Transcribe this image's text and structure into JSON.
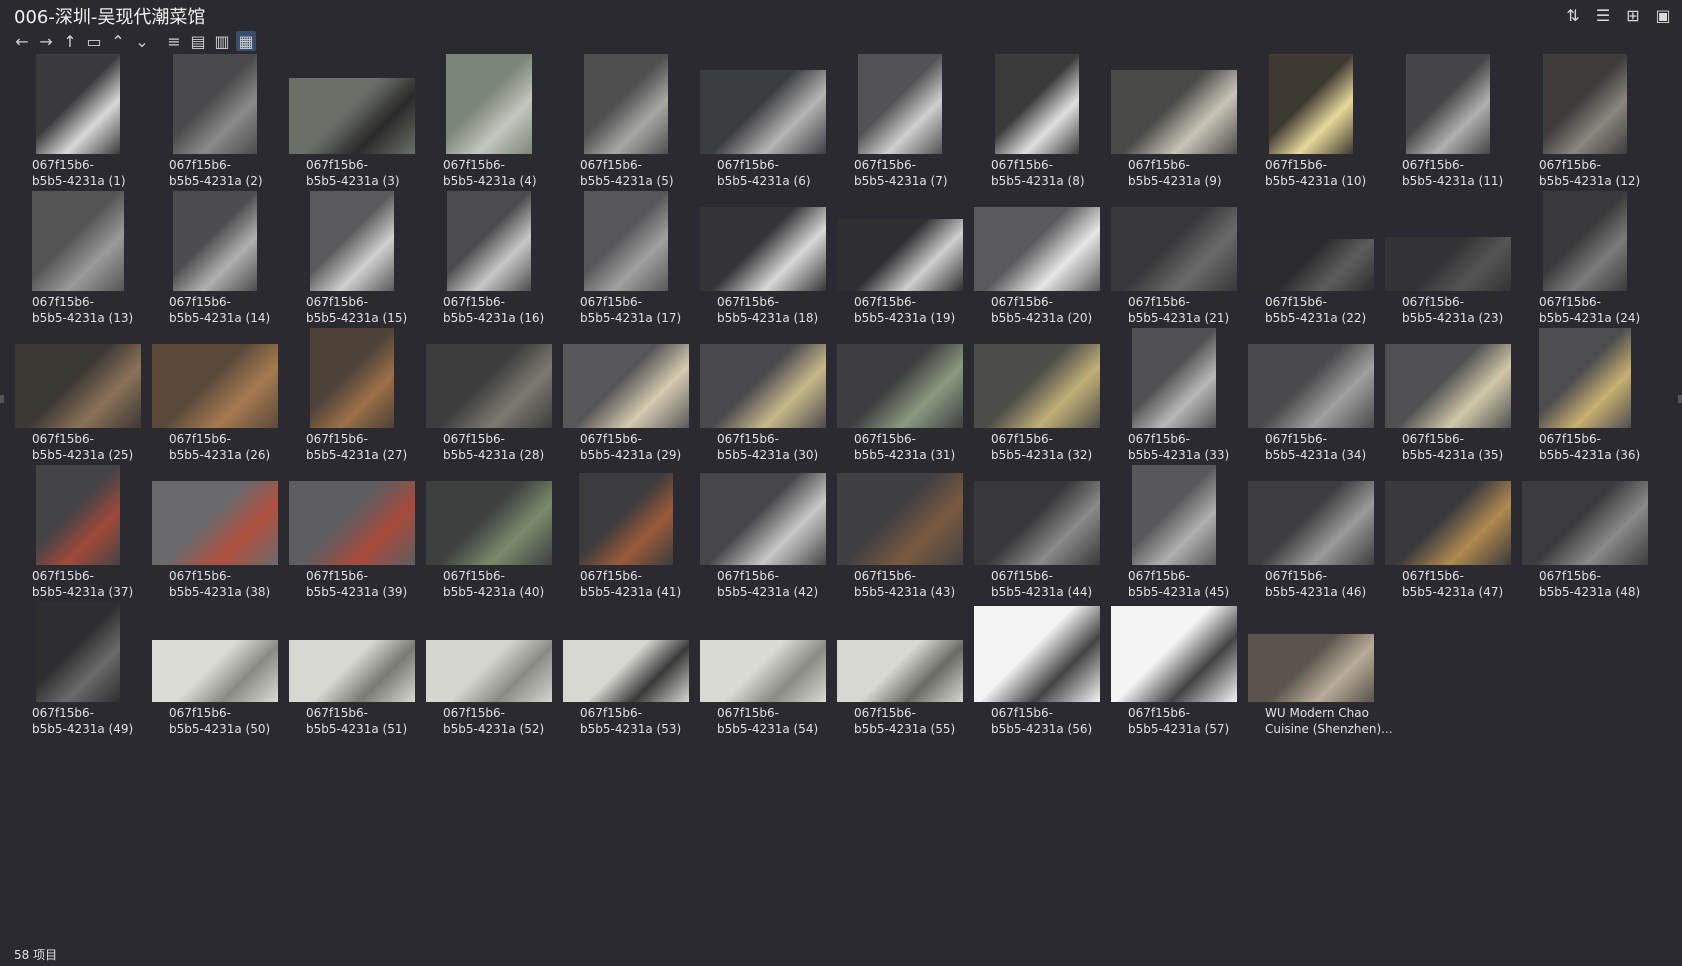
{
  "window": {
    "title": "006-深圳-吴现代潮菜馆"
  },
  "window_actions": [
    {
      "name": "sort-icon",
      "glyph": "⇅"
    },
    {
      "name": "details-pane-icon",
      "glyph": "☰"
    },
    {
      "name": "new-item-icon",
      "glyph": "⊞"
    },
    {
      "name": "clipboard-icon",
      "glyph": "▣"
    }
  ],
  "toolbar": [
    {
      "name": "back-icon",
      "glyph": "←"
    },
    {
      "name": "forward-icon",
      "glyph": "→"
    },
    {
      "name": "up-icon",
      "glyph": "↑"
    },
    {
      "name": "folder-icon",
      "glyph": "▭"
    },
    {
      "name": "chevron-up-icon",
      "glyph": "⌃"
    },
    {
      "name": "chevron-down-icon",
      "glyph": "⌄"
    },
    {
      "name": "list-view-icon",
      "glyph": "≡"
    },
    {
      "name": "details-view-icon",
      "glyph": "▤"
    },
    {
      "name": "tiles-view-icon",
      "glyph": "▥"
    },
    {
      "name": "thumbnail-view-icon",
      "glyph": "▦"
    }
  ],
  "items": [
    {
      "l1": "067f15b6-",
      "l2": "b5b5-4231a (1)",
      "thumb": "#3a3a3c",
      "accent": "#d8d8d8",
      "w": 84,
      "h": 100
    },
    {
      "l1": "067f15b6-",
      "l2": "b5b5-4231a (2)",
      "thumb": "#4a4a4c",
      "accent": "#8a8a8a",
      "w": 84,
      "h": 100
    },
    {
      "l1": "067f15b6-",
      "l2": "b5b5-4231a (3)",
      "thumb": "#6b6f68",
      "accent": "#2a2a2a",
      "w": 126,
      "h": 76
    },
    {
      "l1": "067f15b6-",
      "l2": "b5b5-4231a (4)",
      "thumb": "#7c8676",
      "accent": "#c4c6c0",
      "w": 86,
      "h": 100
    },
    {
      "l1": "067f15b6-",
      "l2": "b5b5-4231a (5)",
      "thumb": "#4f4f50",
      "accent": "#a8a8a4",
      "w": 84,
      "h": 100
    },
    {
      "l1": "067f15b6-",
      "l2": "b5b5-4231a (6)",
      "thumb": "#3c3d40",
      "accent": "#b5b5b5",
      "w": 126,
      "h": 84
    },
    {
      "l1": "067f15b6-",
      "l2": "b5b5-4231a (7)",
      "thumb": "#525254",
      "accent": "#cfcfcf",
      "w": 84,
      "h": 100
    },
    {
      "l1": "067f15b6-",
      "l2": "b5b5-4231a (8)",
      "thumb": "#3b3b3c",
      "accent": "#e0e0e0",
      "w": 84,
      "h": 100
    },
    {
      "l1": "067f15b6-",
      "l2": "b5b5-4231a (9)",
      "thumb": "#4a4a48",
      "accent": "#c8c5b8",
      "w": 126,
      "h": 84
    },
    {
      "l1": "067f15b6-",
      "l2": "b5b5-4231a (10)",
      "thumb": "#3e3a32",
      "accent": "#e8d89a",
      "w": 84,
      "h": 100
    },
    {
      "l1": "067f15b6-",
      "l2": "b5b5-4231a (11)",
      "thumb": "#454547",
      "accent": "#b0b0b0",
      "w": 84,
      "h": 100
    },
    {
      "l1": "067f15b6-",
      "l2": "b5b5-4231a (12)",
      "thumb": "#3d3c3b",
      "accent": "#8a8680",
      "w": 84,
      "h": 100
    },
    {
      "l1": "067f15b6-",
      "l2": "b5b5-4231a (13)",
      "thumb": "#555556",
      "accent": "#9a9a9a",
      "w": 92,
      "h": 100
    },
    {
      "l1": "067f15b6-",
      "l2": "b5b5-4231a (14)",
      "thumb": "#4c4c4e",
      "accent": "#b0b0b0",
      "w": 84,
      "h": 100
    },
    {
      "l1": "067f15b6-",
      "l2": "b5b5-4231a (15)",
      "thumb": "#5a5a5c",
      "accent": "#d0d0d0",
      "w": 84,
      "h": 100
    },
    {
      "l1": "067f15b6-",
      "l2": "b5b5-4231a (16)",
      "thumb": "#4d4d4f",
      "accent": "#c8c8c8",
      "w": 84,
      "h": 100
    },
    {
      "l1": "067f15b6-",
      "l2": "b5b5-4231a (17)",
      "thumb": "#58585a",
      "accent": "#a0a0a0",
      "w": 84,
      "h": 100
    },
    {
      "l1": "067f15b6-",
      "l2": "b5b5-4231a (18)",
      "thumb": "#353537",
      "accent": "#d8d8d8",
      "w": 126,
      "h": 84
    },
    {
      "l1": "067f15b6-",
      "l2": "b5b5-4231a (19)",
      "thumb": "#2f2f31",
      "accent": "#cfcfcf",
      "w": 126,
      "h": 72
    },
    {
      "l1": "067f15b6-",
      "l2": "b5b5-4231a (20)",
      "thumb": "#5a5a5c",
      "accent": "#e6e6e6",
      "w": 126,
      "h": 84
    },
    {
      "l1": "067f15b6-",
      "l2": "b5b5-4231a (21)",
      "thumb": "#38383a",
      "accent": "#6a6a6a",
      "w": 126,
      "h": 84
    },
    {
      "l1": "067f15b6-",
      "l2": "b5b5-4231a (22)",
      "thumb": "#2c2c2e",
      "accent": "#5e5e5e",
      "w": 126,
      "h": 52
    },
    {
      "l1": "067f15b6-",
      "l2": "b5b5-4231a (23)",
      "thumb": "#333335",
      "accent": "#555555",
      "w": 126,
      "h": 54
    },
    {
      "l1": "067f15b6-",
      "l2": "b5b5-4231a (24)",
      "thumb": "#3a3a3c",
      "accent": "#7a7a7a",
      "w": 84,
      "h": 100
    },
    {
      "l1": "067f15b6-",
      "l2": "b5b5-4231a (25)",
      "thumb": "#3c3834",
      "accent": "#8c7358",
      "w": 126,
      "h": 84
    },
    {
      "l1": "067f15b6-",
      "l2": "b5b5-4231a (26)",
      "thumb": "#5a4a3c",
      "accent": "#a67a4e",
      "w": 126,
      "h": 84
    },
    {
      "l1": "067f15b6-",
      "l2": "b5b5-4231a (27)",
      "thumb": "#4e4238",
      "accent": "#9c7048",
      "w": 84,
      "h": 100
    },
    {
      "l1": "067f15b6-",
      "l2": "b5b5-4231a (28)",
      "thumb": "#3c3c3c",
      "accent": "#7c7a70",
      "w": 126,
      "h": 84
    },
    {
      "l1": "067f15b6-",
      "l2": "b5b5-4231a (29)",
      "thumb": "#58585a",
      "accent": "#d6cbb0",
      "w": 126,
      "h": 84
    },
    {
      "l1": "067f15b6-",
      "l2": "b5b5-4231a (30)",
      "thumb": "#4a4a4c",
      "accent": "#c8b88a",
      "w": 126,
      "h": 84
    },
    {
      "l1": "067f15b6-",
      "l2": "b5b5-4231a (31)",
      "thumb": "#3e3e40",
      "accent": "#8a9a80",
      "w": 126,
      "h": 84
    },
    {
      "l1": "067f15b6-",
      "l2": "b5b5-4231a (32)",
      "thumb": "#4c4c48",
      "accent": "#c0b078",
      "w": 126,
      "h": 84
    },
    {
      "l1": "067f15b6-",
      "l2": "b5b5-4231a (33)",
      "thumb": "#505052",
      "accent": "#b8b8b8",
      "w": 84,
      "h": 100
    },
    {
      "l1": "067f15b6-",
      "l2": "b5b5-4231a (34)",
      "thumb": "#4a4a4c",
      "accent": "#a0a0a0",
      "w": 126,
      "h": 84
    },
    {
      "l1": "067f15b6-",
      "l2": "b5b5-4231a (35)",
      "thumb": "#505052",
      "accent": "#d0c8a8",
      "w": 126,
      "h": 84
    },
    {
      "l1": "067f15b6-",
      "l2": "b5b5-4231a (36)",
      "thumb": "#4e4e50",
      "accent": "#c8b070",
      "w": 92,
      "h": 100
    },
    {
      "l1": "067f15b6-",
      "l2": "b5b5-4231a (37)",
      "thumb": "#444446",
      "accent": "#a04a3a",
      "w": 84,
      "h": 100
    },
    {
      "l1": "067f15b6-",
      "l2": "b5b5-4231a (38)",
      "thumb": "#6a6a6c",
      "accent": "#b0503e",
      "w": 126,
      "h": 84
    },
    {
      "l1": "067f15b6-",
      "l2": "b5b5-4231a (39)",
      "thumb": "#5e5e60",
      "accent": "#a84a3c",
      "w": 126,
      "h": 84
    },
    {
      "l1": "067f15b6-",
      "l2": "b5b5-4231a (40)",
      "thumb": "#3e4040",
      "accent": "#7a8a6a",
      "w": 126,
      "h": 84
    },
    {
      "l1": "067f15b6-",
      "l2": "b5b5-4231a (41)",
      "thumb": "#3c3c3e",
      "accent": "#9a5a3a",
      "w": 94,
      "h": 92
    },
    {
      "l1": "067f15b6-",
      "l2": "b5b5-4231a (42)",
      "thumb": "#464648",
      "accent": "#c8c8c8",
      "w": 126,
      "h": 92
    },
    {
      "l1": "067f15b6-",
      "l2": "b5b5-4231a (43)",
      "thumb": "#404042",
      "accent": "#7a5a40",
      "w": 126,
      "h": 92
    },
    {
      "l1": "067f15b6-",
      "l2": "b5b5-4231a (44)",
      "thumb": "#38383a",
      "accent": "#8a8a8a",
      "w": 126,
      "h": 84
    },
    {
      "l1": "067f15b6-",
      "l2": "b5b5-4231a (45)",
      "thumb": "#58585a",
      "accent": "#b0b0b0",
      "w": 84,
      "h": 100
    },
    {
      "l1": "067f15b6-",
      "l2": "b5b5-4231a (46)",
      "thumb": "#3e3e40",
      "accent": "#9a9a9a",
      "w": 126,
      "h": 84
    },
    {
      "l1": "067f15b6-",
      "l2": "b5b5-4231a (47)",
      "thumb": "#3a3a3c",
      "accent": "#b08a50",
      "w": 126,
      "h": 84
    },
    {
      "l1": "067f15b6-",
      "l2": "b5b5-4231a (48)",
      "thumb": "#3c3c3e",
      "accent": "#8a8a8a",
      "w": 126,
      "h": 84
    },
    {
      "l1": "067f15b6-",
      "l2": "b5b5-4231a (49)",
      "thumb": "#2e2e30",
      "accent": "#6a6a6a",
      "w": 84,
      "h": 100
    },
    {
      "l1": "067f15b6-",
      "l2": "b5b5-4231a (50)",
      "thumb": "#dcdcd6",
      "accent": "#8a8a84",
      "w": 126,
      "h": 62
    },
    {
      "l1": "067f15b6-",
      "l2": "b5b5-4231a (51)",
      "thumb": "#d8d8d2",
      "accent": "#7a7a74",
      "w": 126,
      "h": 62
    },
    {
      "l1": "067f15b6-",
      "l2": "b5b5-4231a (52)",
      "thumb": "#d6d6d0",
      "accent": "#8a8a84",
      "w": 126,
      "h": 62
    },
    {
      "l1": "067f15b6-",
      "l2": "b5b5-4231a (53)",
      "thumb": "#d8d8d2",
      "accent": "#3a3a3a",
      "w": 126,
      "h": 62
    },
    {
      "l1": "067f15b6-",
      "l2": "b5b5-4231a (54)",
      "thumb": "#dadad4",
      "accent": "#8a8a84",
      "w": 126,
      "h": 62
    },
    {
      "l1": "067f15b6-",
      "l2": "b5b5-4231a (55)",
      "thumb": "#d8d8d2",
      "accent": "#6a6a64",
      "w": 126,
      "h": 62
    },
    {
      "l1": "067f15b6-",
      "l2": "b5b5-4231a (56)",
      "thumb": "#f4f4f4",
      "accent": "#444444",
      "w": 126,
      "h": 96
    },
    {
      "l1": "067f15b6-",
      "l2": "b5b5-4231a (57)",
      "thumb": "#f4f4f4",
      "accent": "#444444",
      "w": 126,
      "h": 96
    },
    {
      "l1": "WU Modern Chao",
      "l2": "Cuisine (Shenzhen)...",
      "thumb": "#5a544c",
      "accent": "#b8ac98",
      "w": 126,
      "h": 68
    }
  ],
  "status": {
    "count_text": "58 项目"
  }
}
